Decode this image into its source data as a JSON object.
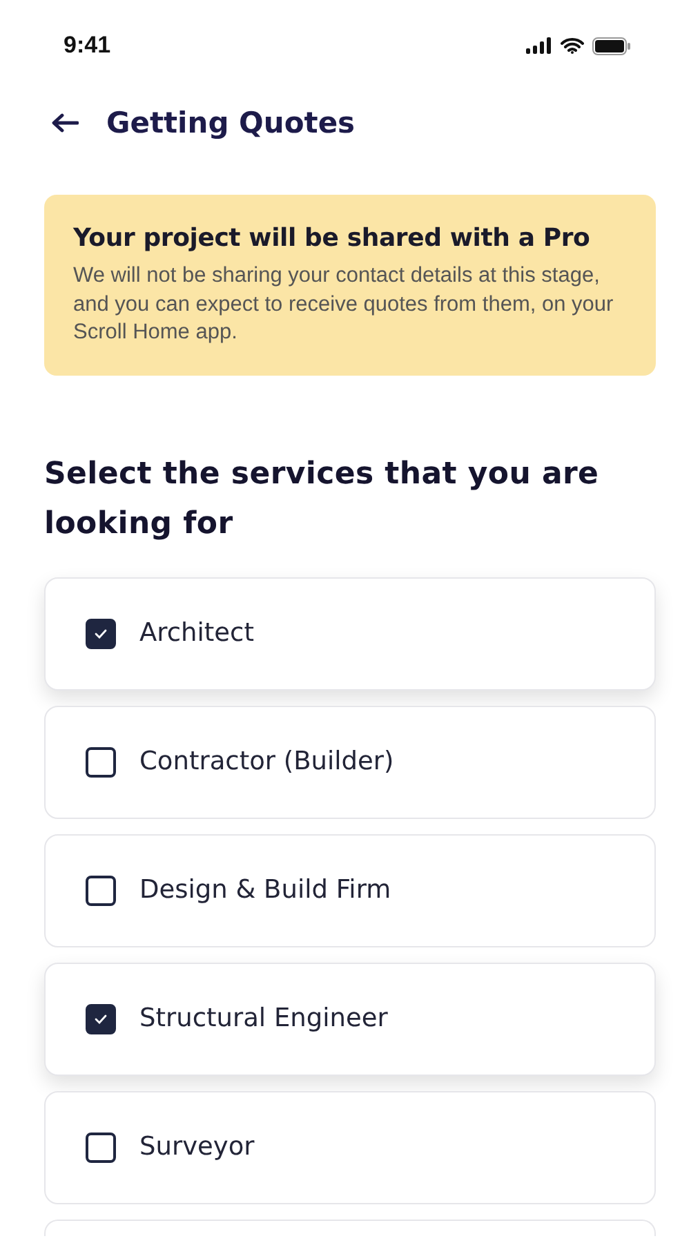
{
  "status_bar": {
    "time": "9:41"
  },
  "header": {
    "title": "Getting Quotes"
  },
  "banner": {
    "title": "Your project will be shared with a Pro",
    "text": "We will not be sharing your contact details at this stage, and you can expect to receive quotes from them, on your Scroll Home app."
  },
  "heading": "Select the services that you are looking for",
  "services": [
    {
      "label": "Architect",
      "checked": true
    },
    {
      "label": "Contractor (Builder)",
      "checked": false
    },
    {
      "label": "Design & Build Firm",
      "checked": false
    },
    {
      "label": "Structural Engineer",
      "checked": true
    },
    {
      "label": "Surveyor",
      "checked": false
    }
  ]
}
